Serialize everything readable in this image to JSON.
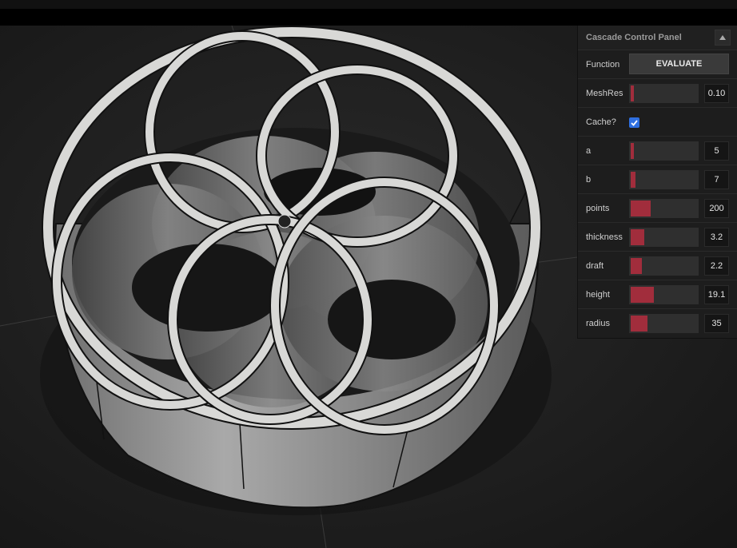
{
  "panel": {
    "title": "Cascade Control Panel",
    "collapse_icon": "caret-up-icon",
    "function": {
      "label": "Function",
      "button_label": "EVALUATE"
    },
    "cache": {
      "label": "Cache?",
      "checked": true
    },
    "sliders": [
      {
        "id": "meshres",
        "label": "MeshRes",
        "value": "0.10",
        "fill": 0.02
      },
      {
        "id": "a",
        "label": "a",
        "value": "5",
        "fill": 0.04
      },
      {
        "id": "b",
        "label": "b",
        "value": "7",
        "fill": 0.07
      },
      {
        "id": "points",
        "label": "points",
        "value": "200",
        "fill": 0.3
      },
      {
        "id": "thickness",
        "label": "thickness",
        "value": "3.2",
        "fill": 0.2
      },
      {
        "id": "draft",
        "label": "draft",
        "value": "2.2",
        "fill": 0.17
      },
      {
        "id": "height",
        "label": "height",
        "value": "19.1",
        "fill": 0.35
      },
      {
        "id": "radius",
        "label": "radius",
        "value": "35",
        "fill": 0.25
      }
    ]
  },
  "colors": {
    "accent": "#a12d3c",
    "checkbox": "#2f6fe0",
    "panel_bg": "#1d1d1d"
  }
}
